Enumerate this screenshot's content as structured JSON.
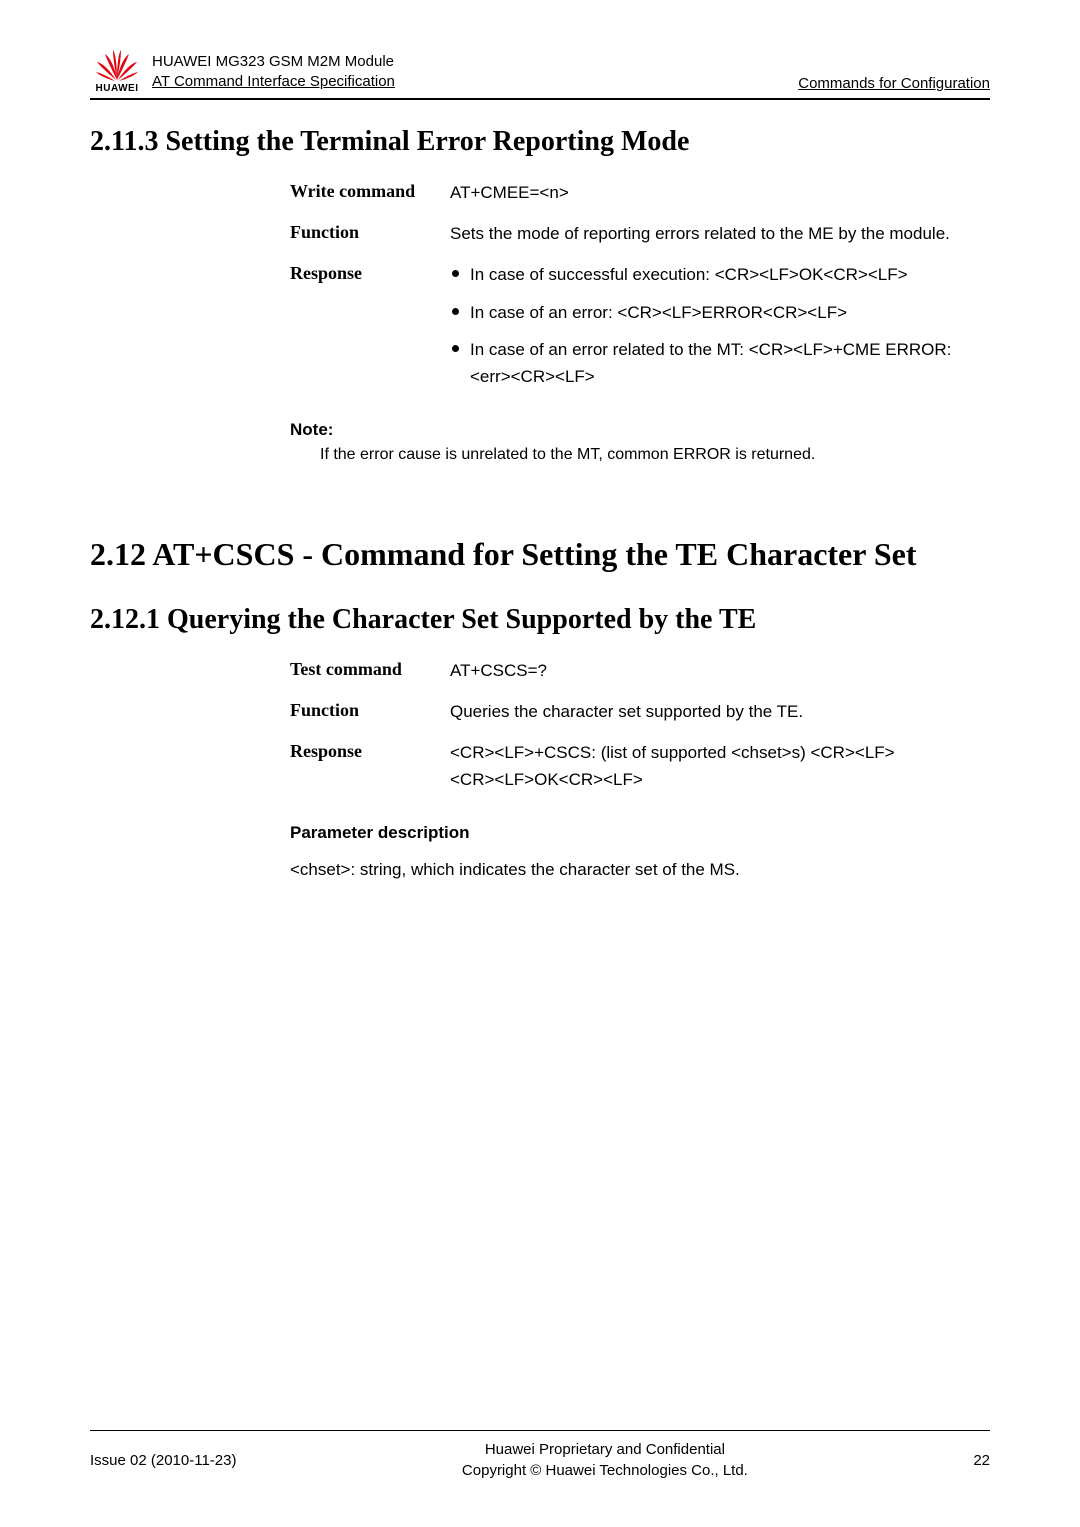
{
  "header": {
    "brand": "HUAWEI",
    "line1": "HUAWEI MG323 GSM M2M Module",
    "line2": "AT Command Interface Specification",
    "right": "Commands for Configuration"
  },
  "s1": {
    "title": "2.11.3 Setting the Terminal Error Reporting Mode",
    "write_label": "Write command",
    "write_value": "AT+CMEE=<n>",
    "function_label": "Function",
    "function_value": "Sets the mode of reporting errors related to the ME by the module.",
    "response_label": "Response",
    "resp_b1": "In case of successful execution: <CR><LF>OK<CR><LF>",
    "resp_b2": "In case of an error: <CR><LF>ERROR<CR><LF>",
    "resp_b3": "In case of an error related to the MT: <CR><LF>+CME ERROR: <err><CR><LF>",
    "note_label": "Note:",
    "note_text": "If the error cause is unrelated to the MT, common ERROR is returned."
  },
  "s2a": {
    "title": "2.12 AT+CSCS - Command for Setting the TE Character Set"
  },
  "s2b": {
    "title": "2.12.1 Querying the Character Set Supported by the TE",
    "test_label": "Test command",
    "test_value": "AT+CSCS=?",
    "function_label": "Function",
    "function_value": "Queries the character set supported by the TE.",
    "response_label": "Response",
    "response_l1": "<CR><LF>+CSCS: (list of supported <chset>s) <CR><LF>",
    "response_l2": "<CR><LF>OK<CR><LF>",
    "param_head": "Parameter description",
    "param_text": "<chset>: string, which indicates the character set of the MS."
  },
  "footer": {
    "left": "Issue 02 (2010-11-23)",
    "center1": "Huawei Proprietary and Confidential",
    "center2": "Copyright © Huawei Technologies Co., Ltd.",
    "right": "22"
  }
}
